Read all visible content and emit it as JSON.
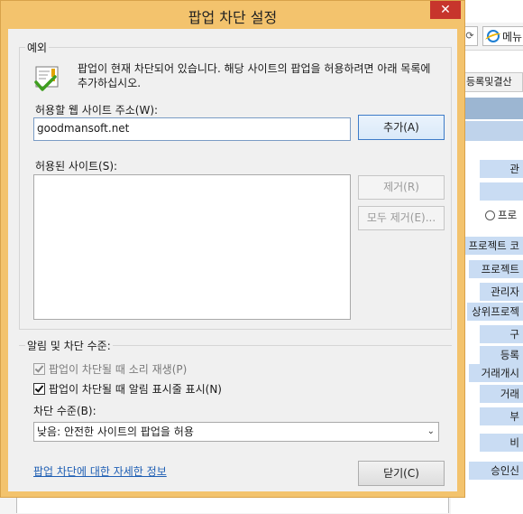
{
  "background": {
    "refresh_glyph": "⟳",
    "menu_label": "메뉴",
    "tab_label": "등록및결산",
    "form_cells": [
      "관",
      "",
      "프로젝트 코",
      "프로젝트",
      "관리자",
      "상위프로젝",
      "구",
      "등록",
      "거래개시",
      "거래",
      "부",
      "비",
      "승인신"
    ],
    "radio_label": "프로"
  },
  "dialog": {
    "title": "팝업 차단 설정",
    "close_glyph": "✕",
    "exceptions": {
      "group_title": "예외",
      "message": "팝업이 현재 차단되어 있습니다. 해당 사이트의 팝업을 허용하려면 아래 목록에 추가하십시오.",
      "address_label": "허용할 웹 사이트 주소(W):",
      "address_value": "goodmansoft.net",
      "add_button": "추가(A)",
      "allowed_label": "허용된 사이트(S):",
      "remove_button": "제거(R)",
      "remove_all_button": "모두 제거(E)..."
    },
    "notifications": {
      "group_title": "알림 및 차단 수준:",
      "sound_label": "팝업이 차단될 때 소리 재생(P)",
      "sound_checked": true,
      "infobar_label": "팝업이 차단될 때 알림 표시줄 표시(N)",
      "infobar_checked": true,
      "level_label": "차단 수준(B):",
      "level_value": "낮음: 안전한 사이트의 팝업을 허용"
    },
    "more_info_link": "팝업 차단에 대한 자세한 정보",
    "close_button": "닫기(C)"
  },
  "colors": {
    "dialog_frame": "#f3c36d",
    "close_red": "#c7352c",
    "link_blue": "#1f5fb4"
  }
}
